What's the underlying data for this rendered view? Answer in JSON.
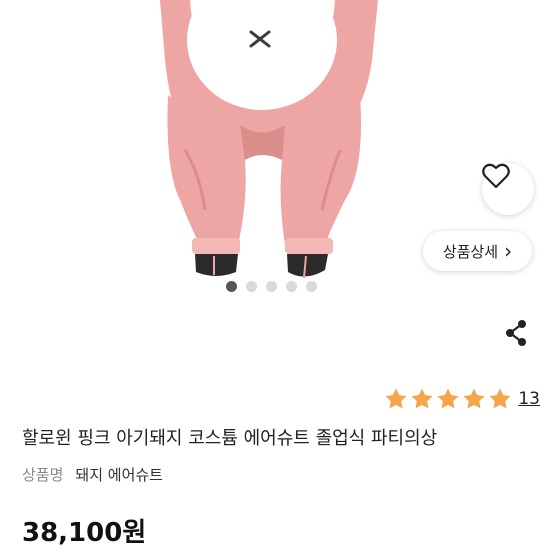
{
  "product": {
    "title": "할로윈 핑크 아기돼지 코스튬 에어슈트 졸업식 파티의상",
    "name_label": "상품명",
    "name_value": "돼지 에어슈트",
    "price": "38,100원",
    "rating": {
      "stars": 5,
      "review_count": "13",
      "star_color": "#F5A54A"
    }
  },
  "gallery": {
    "detail_button_label": "상품상세",
    "detail_chevron": "›",
    "dot_count": 5,
    "active_dot_index": 0,
    "image_subject": "pink inflatable pig costume"
  },
  "icons": {
    "wishlist": "heart-icon",
    "share": "share-icon",
    "detail": "chevron-right-icon"
  },
  "colors": {
    "costume_pink": "#EEA6A4",
    "costume_belly": "#FFFFFF",
    "text_primary": "#222222",
    "text_secondary": "#888888"
  }
}
